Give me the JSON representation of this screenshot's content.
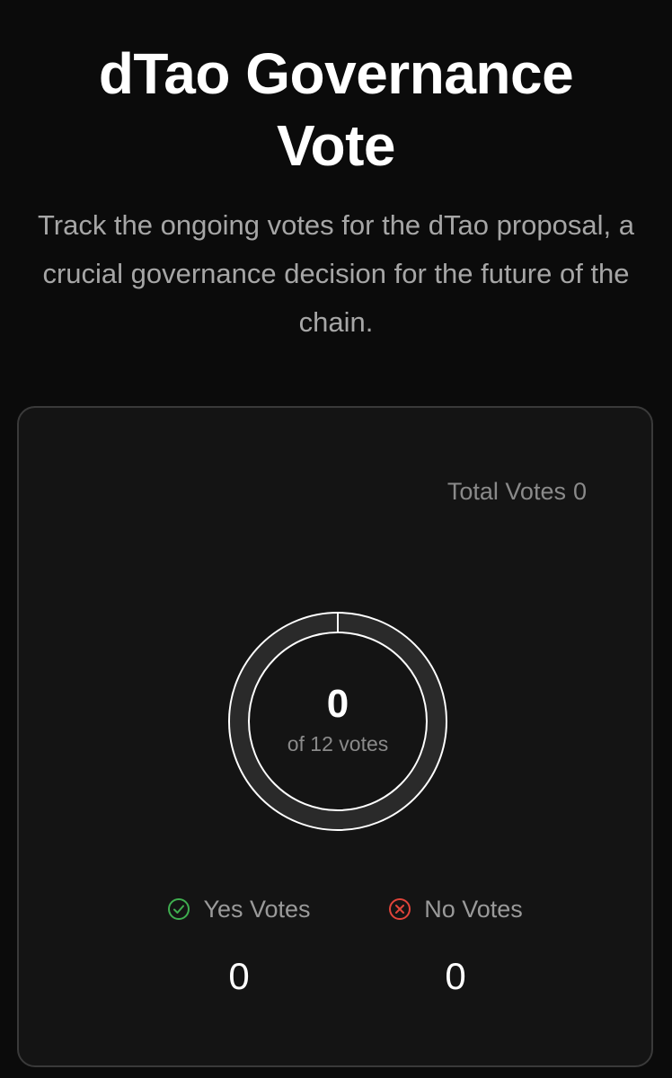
{
  "header": {
    "title": "dTao Governance Vote",
    "subtitle": "Track the ongoing votes for the dTao proposal, a crucial governance decision for the future of the chain."
  },
  "card": {
    "total_votes_label": "Total Votes",
    "total_votes_value": "0",
    "progress": {
      "current": "0",
      "total_label": "of 12 votes",
      "fraction": 0
    },
    "yes": {
      "label": "Yes Votes",
      "value": "0",
      "icon": "check-circle-icon",
      "color": "#3fae4f"
    },
    "no": {
      "label": "No Votes",
      "value": "0",
      "icon": "x-circle-icon",
      "color": "#e0443a"
    }
  },
  "colors": {
    "background": "#0b0b0b",
    "card_background": "#141414",
    "card_border": "#3a3a3a",
    "ring_track": "#2a2a2a",
    "ring_outline": "#ffffff",
    "muted_text": "#8a8a8a"
  }
}
